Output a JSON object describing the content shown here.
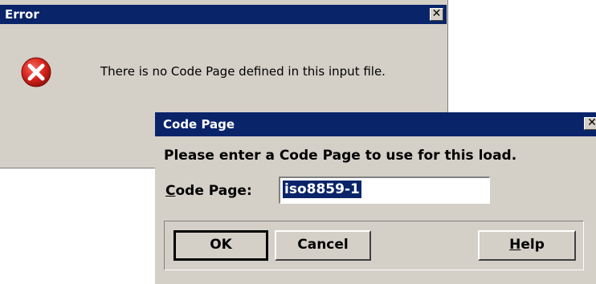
{
  "error_dialog": {
    "title": "Error",
    "close_glyph": "✕",
    "message": "There is no Code Page defined in this input file.",
    "icon": "error-icon"
  },
  "code_page_dialog": {
    "title": "Code Page",
    "close_glyph": "✕",
    "prompt": "Please enter a Code Page to use for this load.",
    "label_mnemonic": "C",
    "label_rest": "ode Page:",
    "input_value": "iso8859-1",
    "buttons": {
      "ok": "OK",
      "cancel": "Cancel",
      "help_mnemonic": "H",
      "help_rest": "elp"
    }
  },
  "colors": {
    "titlebar": "#0a246a",
    "face": "#d4d0c8",
    "error_red": "#d8231b"
  }
}
